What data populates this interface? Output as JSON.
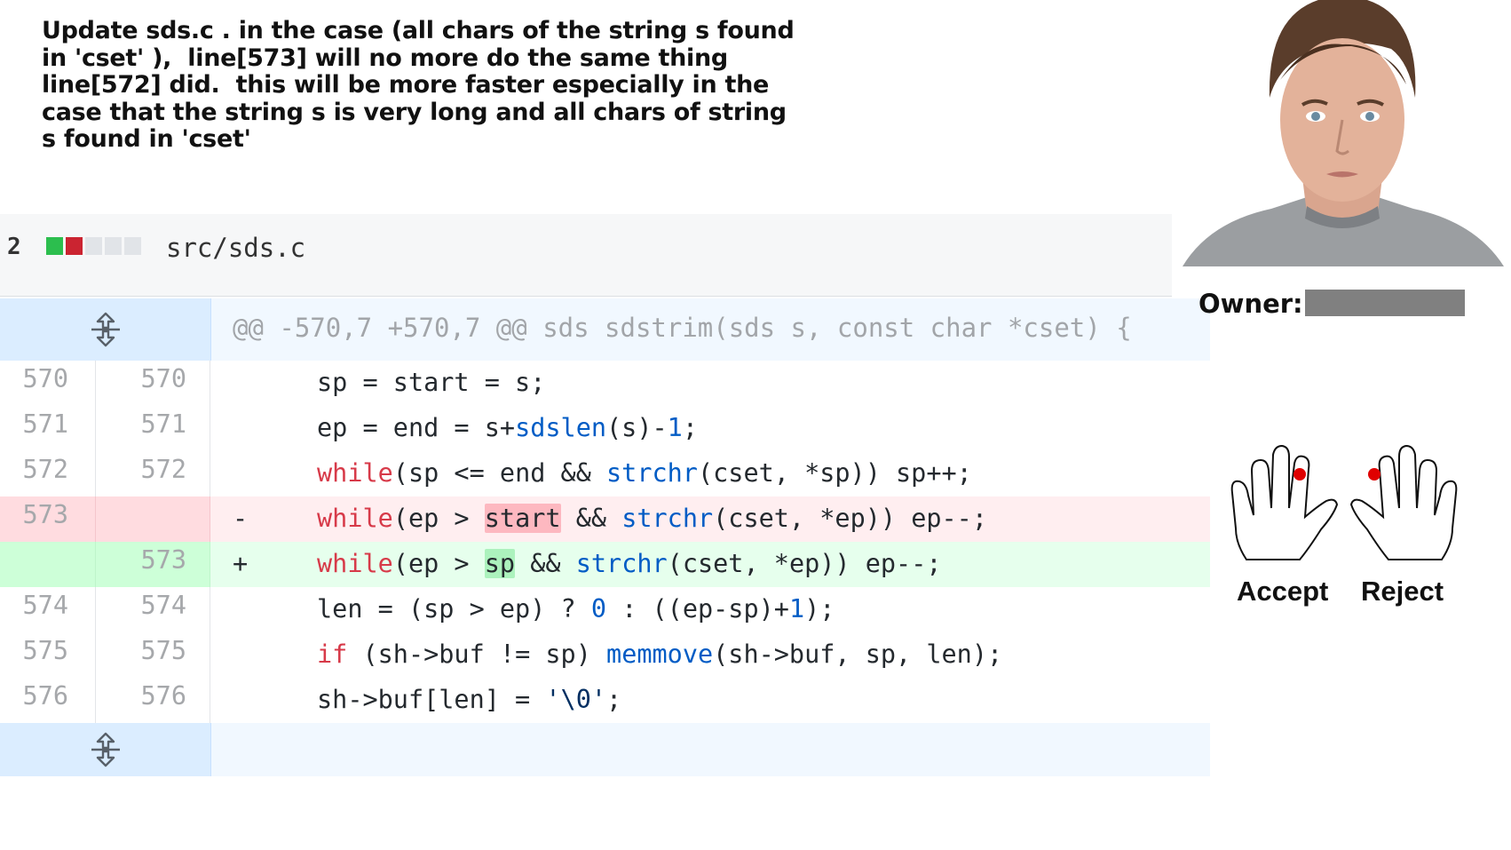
{
  "description": "Update sds.c . in the case (all chars of the string s found\nin 'cset' ),  line[573] will no more do the same thing\nline[572] did.  this will be more faster especially in the\ncase that the string s is very long and all chars of string\ns found in 'cset'",
  "file": {
    "changes": "2",
    "path": "src/sds.c",
    "diffstat_colors": [
      "#2cbe4e",
      "#cb2431",
      "#d1d5da",
      "#d1d5da",
      "#d1d5da"
    ]
  },
  "hunk_header": "@@ -570,7 +570,7 @@ sds sdstrim(sds s, const char *cset) {",
  "lines": [
    {
      "old": "570",
      "new": "570",
      "marker": "",
      "code": "sp = start = s;"
    },
    {
      "old": "571",
      "new": "571",
      "marker": "",
      "code": "ep = end = s+sdslen(s)-1;"
    },
    {
      "old": "572",
      "new": "572",
      "marker": "",
      "code": "while(sp <= end && strchr(cset, *sp)) sp++;"
    },
    {
      "old": "573",
      "new": "",
      "marker": "-",
      "code": "while(ep > start && strchr(cset, *ep)) ep--;"
    },
    {
      "old": "",
      "new": "573",
      "marker": "+",
      "code": "while(ep > sp && strchr(cset, *ep)) ep--;"
    },
    {
      "old": "574",
      "new": "574",
      "marker": "",
      "code": "len = (sp > ep) ? 0 : ((ep-sp)+1);"
    },
    {
      "old": "575",
      "new": "575",
      "marker": "",
      "code": "if (sh->buf != sp) memmove(sh->buf, sp, len);"
    },
    {
      "old": "576",
      "new": "576",
      "marker": "",
      "code": "sh->buf[len] = '\\0';"
    }
  ],
  "owner": {
    "label": "Owner:"
  },
  "actions": {
    "accept": "Accept",
    "reject": "Reject"
  },
  "colors": {
    "owner_redaction": "#808080",
    "finger_dot": "#e00000"
  }
}
